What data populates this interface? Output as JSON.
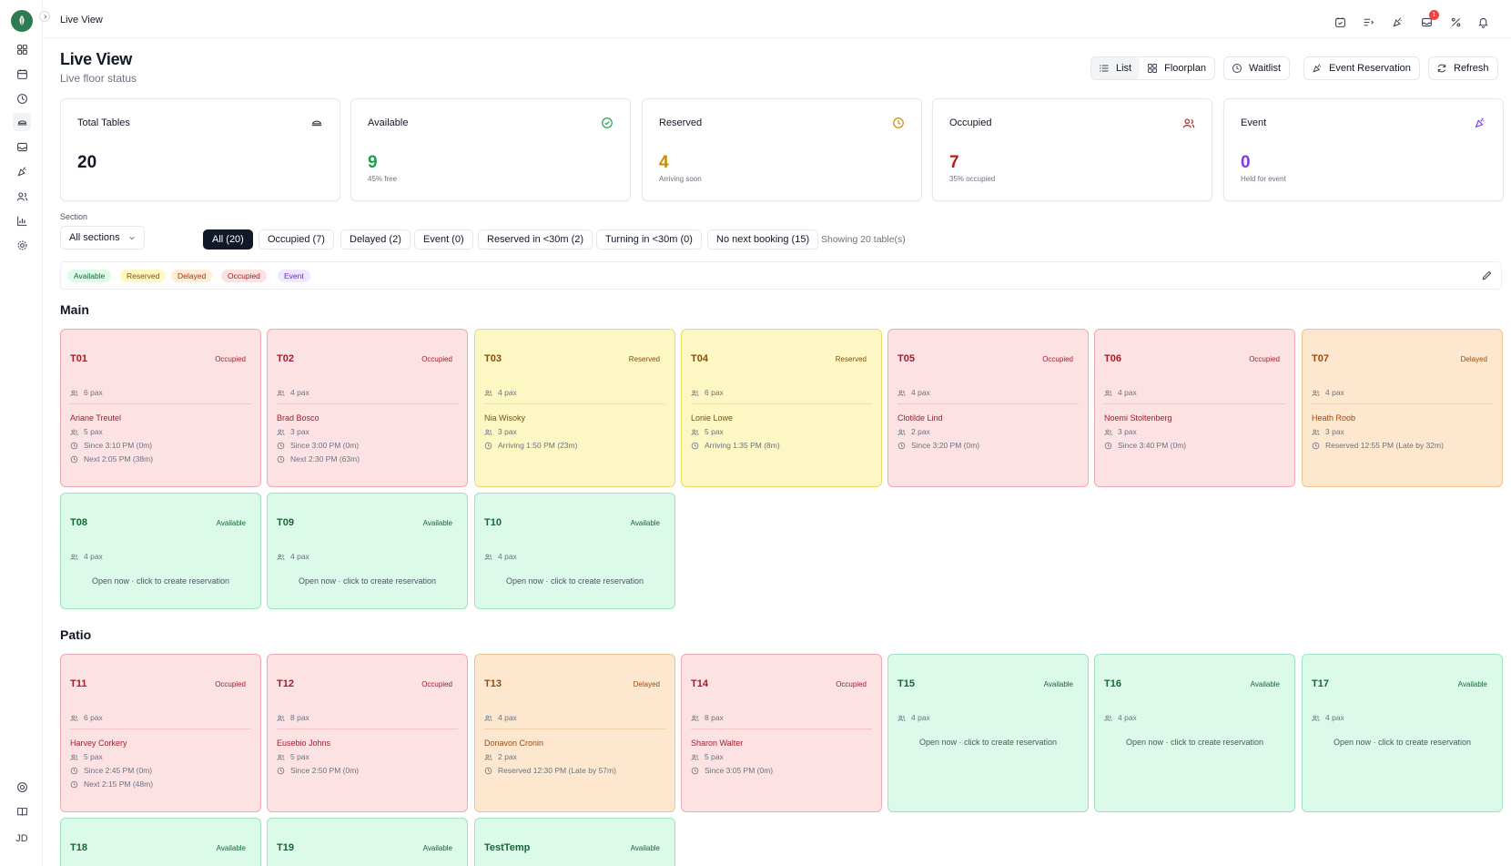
{
  "breadcrumb": "Live View",
  "notification_count": "1",
  "page": {
    "title": "Live View",
    "subtitle": "Live floor status"
  },
  "toolbar": {
    "list": "List",
    "floorplan": "Floorplan",
    "waitlist": "Waitlist",
    "event_reservation": "Event Reservation",
    "refresh": "Refresh"
  },
  "stats": [
    {
      "label": "Total Tables",
      "value": "20",
      "note": "",
      "color": "#111827",
      "icon": "tables-icon"
    },
    {
      "label": "Available",
      "value": "9",
      "note": "45% free",
      "color": "#16a34a",
      "icon": "check-circle-icon"
    },
    {
      "label": "Reserved",
      "value": "4",
      "note": "Arriving soon",
      "color": "#ca8a04",
      "icon": "clock-icon"
    },
    {
      "label": "Occupied",
      "value": "7",
      "note": "35% occupied",
      "color": "#b91c1c",
      "icon": "users-icon"
    },
    {
      "label": "Event",
      "value": "0",
      "note": "Held for event",
      "color": "#7c3aed",
      "icon": "party-icon"
    }
  ],
  "filters": {
    "section_label": "Section",
    "section_value": "All sections",
    "chips": [
      "All (20)",
      "Occupied (7)",
      "Delayed (2)",
      "Event (0)",
      "Reserved in <30m (2)",
      "Turning in <30m (0)",
      "No next booking (15)"
    ],
    "showing": "Showing 20 table(s)"
  },
  "legend": [
    "Available",
    "Reserved",
    "Delayed",
    "Occupied",
    "Event"
  ],
  "sections": {
    "main": "Main",
    "patio": "Patio"
  },
  "open_text": "Open now · click to create reservation",
  "tables": [
    {
      "id": "T01",
      "status": "Occupied",
      "pax": "6 pax",
      "guest": "Ariane Treutel",
      "party": "5 pax",
      "time": "Since 3:10 PM (0m)",
      "next": "Next 2:05 PM (38m)"
    },
    {
      "id": "T02",
      "status": "Occupied",
      "pax": "4 pax",
      "guest": "Brad Bosco",
      "party": "3 pax",
      "time": "Since 3:00 PM (0m)",
      "next": "Next 2:30 PM (63m)"
    },
    {
      "id": "T03",
      "status": "Reserved",
      "pax": "4 pax",
      "guest": "Nia Wisoky",
      "party": "3 pax",
      "time": "Arriving 1:50 PM (23m)",
      "next": ""
    },
    {
      "id": "T04",
      "status": "Reserved",
      "pax": "6 pax",
      "guest": "Lonie Lowe",
      "party": "5 pax",
      "time": "Arriving 1:35 PM (8m)",
      "next": ""
    },
    {
      "id": "T05",
      "status": "Occupied",
      "pax": "4 pax",
      "guest": "Clotilde Lind",
      "party": "2 pax",
      "time": "Since 3:20 PM (0m)",
      "next": ""
    },
    {
      "id": "T06",
      "status": "Occupied",
      "pax": "4 pax",
      "guest": "Noemi Stoltenberg",
      "party": "3 pax",
      "time": "Since 3:40 PM (0m)",
      "next": ""
    },
    {
      "id": "T07",
      "status": "Delayed",
      "pax": "4 pax",
      "guest": "Heath Roob",
      "party": "3 pax",
      "time": "Reserved 12:55 PM (Late by 32m)",
      "next": ""
    },
    {
      "id": "T08",
      "status": "Available",
      "pax": "4 pax"
    },
    {
      "id": "T09",
      "status": "Available",
      "pax": "4 pax"
    },
    {
      "id": "T10",
      "status": "Available",
      "pax": "4 pax"
    },
    {
      "id": "T11",
      "status": "Occupied",
      "pax": "6 pax",
      "guest": "Harvey Corkery",
      "party": "5 pax",
      "time": "Since 2:45 PM (0m)",
      "next": "Next 2:15 PM (48m)"
    },
    {
      "id": "T12",
      "status": "Occupied",
      "pax": "8 pax",
      "guest": "Eusebio Johns",
      "party": "5 pax",
      "time": "Since 2:50 PM (0m)",
      "next": ""
    },
    {
      "id": "T13",
      "status": "Delayed",
      "pax": "4 pax",
      "guest": "Donavon Cronin",
      "party": "2 pax",
      "time": "Reserved 12:30 PM (Late by 57m)",
      "next": ""
    },
    {
      "id": "T14",
      "status": "Occupied",
      "pax": "8 pax",
      "guest": "Sharon Walter",
      "party": "5 pax",
      "time": "Since 3:05 PM (0m)",
      "next": ""
    },
    {
      "id": "T15",
      "status": "Available",
      "pax": "4 pax"
    },
    {
      "id": "T16",
      "status": "Available",
      "pax": "4 pax"
    },
    {
      "id": "T17",
      "status": "Available",
      "pax": "4 pax"
    },
    {
      "id": "T18",
      "status": "Available",
      "pax": ""
    },
    {
      "id": "T19",
      "status": "Available",
      "pax": ""
    },
    {
      "id": "TestTemp",
      "status": "Available",
      "pax": ""
    }
  ],
  "user_initials": "JD"
}
